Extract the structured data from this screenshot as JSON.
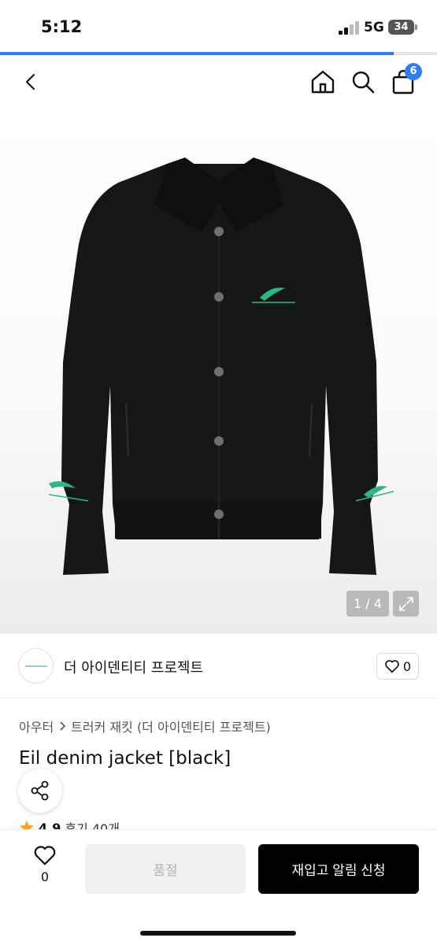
{
  "status_bar": {
    "time": "5:12",
    "network": "5G",
    "battery": "34"
  },
  "page_load_progress": 0.9,
  "nav": {
    "cart_count": "6"
  },
  "gallery": {
    "counter": "1 / 4"
  },
  "brand": {
    "name": "더 아이덴티티 프로젝트",
    "likes": "0"
  },
  "breadcrumb": {
    "category": "아우터",
    "subcategory": "트러커 재킷 (더 아이덴티티 프로젝트)"
  },
  "product": {
    "title": "Eil denim jacket [black]",
    "rating": "4.9",
    "reviews": "후기 40개"
  },
  "bottom_bar": {
    "wish_count": "0",
    "soldout_label": "품절",
    "restock_label": "재입고 알림 신청"
  },
  "colors": {
    "accent": "#2f7ff0",
    "jacket": "#141617",
    "embroidery": "#2fb58a",
    "star": "#f5a623"
  },
  "icons": [
    "back-icon",
    "home-icon",
    "search-icon",
    "cart-icon",
    "heart-icon",
    "share-icon",
    "expand-icon",
    "star-icon"
  ]
}
